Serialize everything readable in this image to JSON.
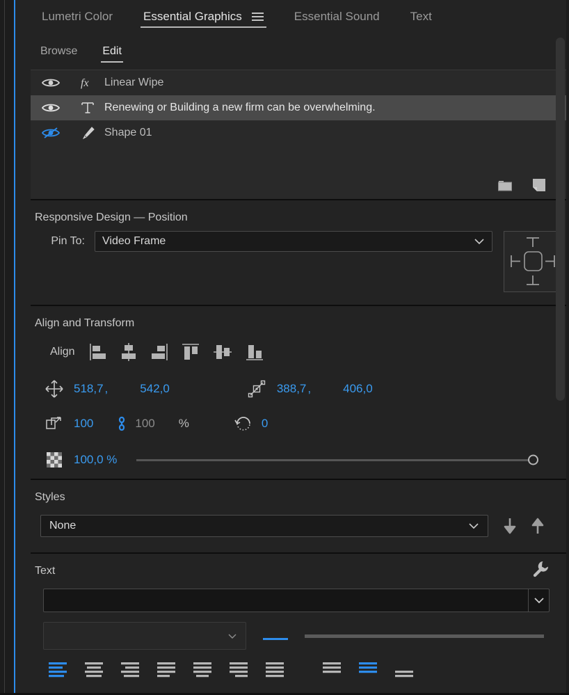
{
  "window": {
    "accent_color": "#2d8ceb",
    "panel_bg": "#232323"
  },
  "tabs": [
    {
      "label": "Lumetri Color",
      "active": false
    },
    {
      "label": "Essential Graphics",
      "active": true,
      "menu_icon": "hamburger-menu-icon"
    },
    {
      "label": "Essential Sound",
      "active": false
    },
    {
      "label": "Text",
      "active": false
    }
  ],
  "subtabs": [
    {
      "label": "Browse",
      "active": false
    },
    {
      "label": "Edit",
      "active": true
    }
  ],
  "layers": [
    {
      "name": "Linear Wipe",
      "type_icon": "fx-icon",
      "visible": true,
      "selected": false
    },
    {
      "name": "Renewing or Building a new firm can be overwhelming.",
      "type_icon": "text-type-icon",
      "visible": true,
      "selected": true
    },
    {
      "name": "Shape 01",
      "type_icon": "pen-tool-icon",
      "visible": false,
      "selected": false
    }
  ],
  "layers_footer": {
    "new_folder": "new-folder-icon",
    "new_layer": "new-layer-icon"
  },
  "responsive_design": {
    "title": "Responsive Design — Position",
    "pin_label": "Pin To:",
    "pin_value": "Video Frame",
    "pin_options": [
      "Video Frame"
    ]
  },
  "align_and_transform": {
    "title": "Align and Transform",
    "align_label": "Align",
    "align_buttons": [
      "align-left-icon",
      "align-center-horizontal-icon",
      "align-right-icon",
      "align-top-icon",
      "align-center-vertical-icon",
      "align-bottom-icon"
    ],
    "position": {
      "icon": "move-position-icon",
      "x": "518,7",
      "y": "542,0",
      "separator": ","
    },
    "anchor": {
      "icon": "anchor-point-icon",
      "x": "388,7",
      "y": "406,0",
      "separator": ","
    },
    "scale": {
      "icon": "scale-icon",
      "value": "100",
      "link_icon": "link-chain-icon",
      "linked_value": "100",
      "unit": "%"
    },
    "rotation": {
      "icon": "rotation-icon",
      "value": "0"
    },
    "opacity": {
      "icon": "opacity-checker-icon",
      "value": "100,0 %",
      "slider_percent": 100
    }
  },
  "styles": {
    "title": "Styles",
    "value": "None",
    "options": [
      "None"
    ],
    "push_icon": "arrow-down-icon",
    "pull_icon": "arrow-up-icon"
  },
  "text": {
    "title": "Text",
    "settings_icon": "wrench-icon",
    "font_family_value": "",
    "font_style_value": "",
    "font_size_value": "",
    "align_buttons": [
      {
        "name": "text-align-left-icon",
        "active": true
      },
      {
        "name": "text-align-center-icon",
        "active": false
      },
      {
        "name": "text-align-right-icon",
        "active": false
      },
      {
        "name": "text-justify-last-left-icon",
        "active": false
      },
      {
        "name": "text-justify-last-center-icon",
        "active": false
      },
      {
        "name": "text-justify-last-right-icon",
        "active": false
      },
      {
        "name": "text-justify-all-icon",
        "active": false
      },
      {
        "name": "text-align-top-icon",
        "active": false
      },
      {
        "name": "text-align-vertical-center-icon",
        "active": true
      },
      {
        "name": "text-align-bottom-icon",
        "active": false
      }
    ]
  }
}
